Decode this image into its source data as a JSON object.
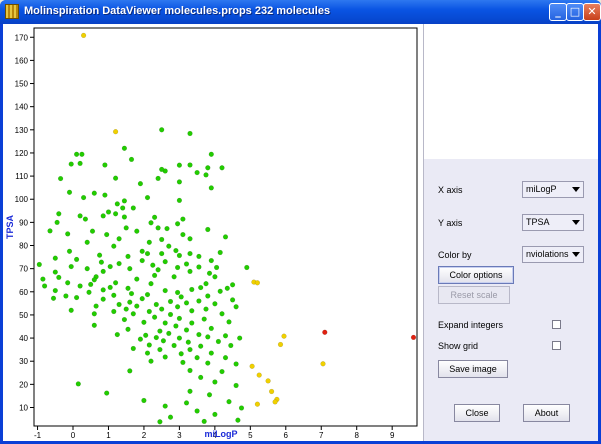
{
  "window": {
    "title": "Molinspiration DataViewer molecules.props 232 molecules",
    "minimize_glyph": "_",
    "maximize_glyph": "□",
    "close_glyph": "✕"
  },
  "controls": {
    "x_axis_label": "X axis",
    "x_axis_value": "miLogP",
    "y_axis_label": "Y axis",
    "y_axis_value": "TPSA",
    "color_by_label": "Color by",
    "color_by_value": "nviolations",
    "color_options_label": "Color options",
    "reset_scale_label": "Reset scale",
    "expand_integers_label": "Expand integers",
    "expand_integers_checked": false,
    "show_grid_label": "Show grid",
    "show_grid_checked": false,
    "save_image_label": "Save image",
    "close_label": "Close",
    "about_label": "About"
  },
  "chart_data": {
    "type": "scatter",
    "xlabel": "miLogP",
    "ylabel": "TPSA",
    "xlim": [
      -1.1,
      9.7
    ],
    "ylim": [
      2,
      174
    ],
    "xticks": [
      -1,
      0,
      1,
      2,
      3,
      4,
      5,
      6,
      7,
      8,
      9
    ],
    "yticks": [
      10,
      20,
      30,
      40,
      50,
      60,
      70,
      80,
      90,
      100,
      110,
      120,
      130,
      140,
      150,
      160,
      170
    ],
    "grid": false,
    "colors": {
      "0": "#22cc00",
      "1": "#f0d000",
      "2": "#e02010"
    },
    "points": [
      [
        0.3,
        170.8,
        1
      ],
      [
        1.2,
        129.2,
        1
      ],
      [
        9.6,
        40.3,
        2
      ],
      [
        7.1,
        42.5,
        2
      ],
      [
        5.1,
        64.2,
        1
      ],
      [
        5.2,
        63.9,
        1
      ],
      [
        5.95,
        40.8,
        1
      ],
      [
        5.85,
        37.2,
        1
      ],
      [
        7.05,
        28.9,
        1
      ],
      [
        5.05,
        27.8,
        1
      ],
      [
        5.25,
        24.0,
        1
      ],
      [
        5.5,
        21.5,
        1
      ],
      [
        5.6,
        16.9,
        1
      ],
      [
        5.75,
        13.5,
        1
      ],
      [
        5.7,
        12.4,
        1
      ],
      [
        5.2,
        11.4,
        1
      ],
      [
        2.5,
        130.0,
        0
      ],
      [
        3.3,
        128.4,
        0
      ],
      [
        1.45,
        122.0,
        0
      ],
      [
        0.1,
        119.4,
        0
      ],
      [
        0.25,
        119.4,
        0
      ],
      [
        3.9,
        119.4,
        0
      ],
      [
        1.65,
        117.2,
        0
      ],
      [
        0.2,
        115.5,
        0
      ],
      [
        -0.05,
        115.2,
        0
      ],
      [
        0.9,
        114.8,
        0
      ],
      [
        3.0,
        114.7,
        0
      ],
      [
        3.3,
        114.8,
        0
      ],
      [
        4.2,
        113.6,
        0
      ],
      [
        3.8,
        113.6,
        0
      ],
      [
        2.6,
        112.2,
        0
      ],
      [
        2.5,
        112.9,
        0
      ],
      [
        3.5,
        111.5,
        0
      ],
      [
        3.75,
        110.5,
        0
      ],
      [
        -0.35,
        108.9,
        0
      ],
      [
        1.2,
        109.1,
        0
      ],
      [
        2.4,
        109.0,
        0
      ],
      [
        3.0,
        107.5,
        0
      ],
      [
        1.9,
        106.7,
        0
      ],
      [
        3.9,
        104.9,
        0
      ],
      [
        -0.1,
        103.0,
        0
      ],
      [
        0.6,
        102.6,
        0
      ],
      [
        0.9,
        101.8,
        0
      ],
      [
        0.3,
        100.7,
        0
      ],
      [
        2.1,
        100.7,
        0
      ],
      [
        1.45,
        99.3,
        0
      ],
      [
        1.25,
        98.0,
        0
      ],
      [
        3.0,
        99.5,
        0
      ],
      [
        1.4,
        96.2,
        0
      ],
      [
        1.7,
        96.2,
        0
      ],
      [
        1.0,
        94.5,
        0
      ],
      [
        1.2,
        93.7,
        0
      ],
      [
        -0.4,
        93.7,
        0
      ],
      [
        0.2,
        92.8,
        0
      ],
      [
        0.85,
        92.8,
        0
      ],
      [
        1.45,
        92.3,
        0
      ],
      [
        2.3,
        92.2,
        0
      ],
      [
        0.35,
        91.4,
        0
      ],
      [
        3.1,
        91.4,
        0
      ],
      [
        -0.45,
        90.0,
        0
      ],
      [
        2.2,
        89.8,
        0
      ],
      [
        2.95,
        89.4,
        0
      ],
      [
        1.5,
        87.6,
        0
      ],
      [
        2.4,
        87.6,
        0
      ],
      [
        2.65,
        87.3,
        0
      ],
      [
        3.8,
        86.9,
        0
      ],
      [
        -0.65,
        86.3,
        0
      ],
      [
        0.55,
        86.2,
        0
      ],
      [
        1.8,
        86.2,
        0
      ],
      [
        -0.15,
        85.0,
        0
      ],
      [
        0.95,
        84.7,
        0
      ],
      [
        3.1,
        84.7,
        0
      ],
      [
        4.3,
        83.7,
        0
      ],
      [
        1.3,
        82.9,
        0
      ],
      [
        2.5,
        82.6,
        0
      ],
      [
        3.3,
        82.9,
        0
      ],
      [
        0.4,
        81.4,
        0
      ],
      [
        2.15,
        81.4,
        0
      ],
      [
        1.15,
        79.7,
        0
      ],
      [
        2.7,
        79.7,
        0
      ],
      [
        -0.1,
        77.5,
        0
      ],
      [
        1.95,
        77.5,
        0
      ],
      [
        2.1,
        76.5,
        0
      ],
      [
        2.5,
        76.5,
        0
      ],
      [
        2.9,
        77.8,
        0
      ],
      [
        3.3,
        76.5,
        0
      ],
      [
        4.15,
        77.0,
        0
      ],
      [
        0.75,
        75.8,
        0
      ],
      [
        1.55,
        75.3,
        0
      ],
      [
        3.0,
        75.7,
        0
      ],
      [
        3.55,
        75.3,
        0
      ],
      [
        -0.5,
        74.5,
        0
      ],
      [
        0.1,
        74.0,
        0
      ],
      [
        1.95,
        73.5,
        0
      ],
      [
        2.6,
        73.0,
        0
      ],
      [
        3.9,
        73.5,
        0
      ],
      [
        0.8,
        72.8,
        0
      ],
      [
        1.3,
        72.2,
        0
      ],
      [
        3.2,
        72.0,
        0
      ],
      [
        -0.95,
        71.8,
        0
      ],
      [
        2.25,
        71.5,
        0
      ],
      [
        -0.05,
        70.9,
        0
      ],
      [
        1.05,
        70.9,
        0
      ],
      [
        2.95,
        70.5,
        0
      ],
      [
        3.55,
        70.7,
        0
      ],
      [
        4.05,
        70.5,
        0
      ],
      [
        4.9,
        70.5,
        0
      ],
      [
        0.4,
        70.0,
        0
      ],
      [
        1.6,
        70.0,
        0
      ],
      [
        2.4,
        69.5,
        0
      ],
      [
        -0.5,
        68.5,
        0
      ],
      [
        0.85,
        68.8,
        0
      ],
      [
        3.3,
        68.8,
        0
      ],
      [
        3.85,
        68.0,
        0
      ],
      [
        -0.4,
        66.2,
        0
      ],
      [
        0.65,
        66.5,
        0
      ],
      [
        2.3,
        67.1,
        0
      ],
      [
        2.85,
        66.5,
        0
      ],
      [
        4.0,
        66.5,
        0
      ],
      [
        -0.85,
        65.5,
        0
      ],
      [
        0.6,
        65.2,
        0
      ],
      [
        1.8,
        65.5,
        0
      ],
      [
        -0.15,
        63.9,
        0
      ],
      [
        0.5,
        63.2,
        0
      ],
      [
        1.2,
        63.9,
        0
      ],
      [
        2.2,
        63.5,
        0
      ],
      [
        3.75,
        63.5,
        0
      ],
      [
        4.5,
        63.0,
        0
      ],
      [
        -0.8,
        62.5,
        0
      ],
      [
        0.2,
        62.5,
        0
      ],
      [
        1.05,
        61.9,
        0
      ],
      [
        1.55,
        61.5,
        0
      ],
      [
        3.6,
        61.8,
        0
      ],
      [
        4.35,
        61.5,
        0
      ],
      [
        -0.5,
        60.5,
        0
      ],
      [
        0.85,
        60.8,
        0
      ],
      [
        2.6,
        60.5,
        0
      ],
      [
        3.35,
        61.0,
        0
      ],
      [
        4.15,
        60.2,
        0
      ],
      [
        0.45,
        59.8,
        0
      ],
      [
        1.65,
        59.2,
        0
      ],
      [
        2.95,
        59.7,
        0
      ],
      [
        -0.2,
        58.2,
        0
      ],
      [
        1.15,
        58.5,
        0
      ],
      [
        2.1,
        58.8,
        0
      ],
      [
        3.8,
        58.2,
        0
      ],
      [
        0.1,
        57.5,
        0
      ],
      [
        3.05,
        57.8,
        0
      ],
      [
        -0.55,
        57.2,
        0
      ],
      [
        0.85,
        56.8,
        0
      ],
      [
        1.95,
        57.0,
        0
      ],
      [
        4.5,
        56.5,
        0
      ],
      [
        1.6,
        55.5,
        0
      ],
      [
        2.75,
        55.8,
        0
      ],
      [
        3.55,
        56.0,
        0
      ],
      [
        1.3,
        54.5,
        0
      ],
      [
        2.35,
        54.5,
        0
      ],
      [
        3.2,
        55.2,
        0
      ],
      [
        4.0,
        54.8,
        0
      ],
      [
        0.65,
        53.8,
        0
      ],
      [
        1.8,
        53.8,
        0
      ],
      [
        2.95,
        53.5,
        0
      ],
      [
        4.6,
        53.5,
        0
      ],
      [
        1.5,
        52.5,
        0
      ],
      [
        2.5,
        52.5,
        0
      ],
      [
        3.75,
        52.5,
        0
      ],
      [
        -0.05,
        52.0,
        0
      ],
      [
        1.15,
        51.5,
        0
      ],
      [
        2.15,
        51.5,
        0
      ],
      [
        3.35,
        51.8,
        0
      ],
      [
        0.6,
        50.5,
        0
      ],
      [
        1.7,
        50.5,
        0
      ],
      [
        2.75,
        50.2,
        0
      ],
      [
        4.2,
        50.5,
        0
      ],
      [
        2.3,
        49.0,
        0
      ],
      [
        3.0,
        48.5,
        0
      ],
      [
        1.45,
        48.0,
        0
      ],
      [
        3.7,
        48.2,
        0
      ],
      [
        2.0,
        46.8,
        0
      ],
      [
        2.6,
        46.5,
        0
      ],
      [
        3.35,
        46.5,
        0
      ],
      [
        4.4,
        47.0,
        0
      ],
      [
        0.6,
        45.5,
        0
      ],
      [
        2.9,
        45.2,
        0
      ],
      [
        3.9,
        44.2,
        0
      ],
      [
        1.55,
        43.8,
        0
      ],
      [
        2.45,
        43.0,
        0
      ],
      [
        3.2,
        43.5,
        0
      ],
      [
        2.05,
        41.2,
        0
      ],
      [
        2.7,
        42.0,
        0
      ],
      [
        3.55,
        41.5,
        0
      ],
      [
        4.3,
        41.0,
        0
      ],
      [
        1.25,
        41.5,
        0
      ],
      [
        2.35,
        40.2,
        0
      ],
      [
        3.0,
        40.0,
        0
      ],
      [
        3.8,
        40.5,
        0
      ],
      [
        4.7,
        40.0,
        0
      ],
      [
        1.9,
        39.5,
        0
      ],
      [
        2.55,
        38.8,
        0
      ],
      [
        3.25,
        38.2,
        0
      ],
      [
        4.1,
        38.5,
        0
      ],
      [
        2.15,
        37.0,
        0
      ],
      [
        2.85,
        36.8,
        0
      ],
      [
        3.6,
        36.5,
        0
      ],
      [
        4.45,
        36.8,
        0
      ],
      [
        1.7,
        35.5,
        0
      ],
      [
        2.45,
        35.0,
        0
      ],
      [
        3.3,
        35.0,
        0
      ],
      [
        2.1,
        33.5,
        0
      ],
      [
        3.05,
        33.2,
        0
      ],
      [
        3.9,
        33.5,
        0
      ],
      [
        2.6,
        31.8,
        0
      ],
      [
        3.5,
        31.5,
        0
      ],
      [
        4.3,
        31.5,
        0
      ],
      [
        2.2,
        30.0,
        0
      ],
      [
        3.1,
        29.5,
        0
      ],
      [
        3.8,
        29.2,
        0
      ],
      [
        4.6,
        28.8,
        0
      ],
      [
        1.6,
        25.8,
        0
      ],
      [
        3.3,
        26.0,
        0
      ],
      [
        4.2,
        25.5,
        0
      ],
      [
        3.6,
        23.0,
        0
      ],
      [
        4.0,
        21.0,
        0
      ],
      [
        0.15,
        20.2,
        0
      ],
      [
        4.6,
        19.5,
        0
      ],
      [
        3.3,
        17.0,
        0
      ],
      [
        0.95,
        16.2,
        0
      ],
      [
        3.85,
        15.5,
        0
      ],
      [
        2.0,
        13.0,
        0
      ],
      [
        4.4,
        12.5,
        0
      ],
      [
        3.2,
        12.0,
        0
      ],
      [
        2.6,
        10.6,
        0
      ],
      [
        4.75,
        9.8,
        0
      ],
      [
        3.5,
        8.5,
        0
      ],
      [
        4.0,
        7.0,
        0
      ],
      [
        2.75,
        5.8,
        0
      ],
      [
        4.65,
        4.5,
        0
      ],
      [
        3.7,
        4.0,
        0
      ],
      [
        2.45,
        3.8,
        0
      ]
    ]
  }
}
